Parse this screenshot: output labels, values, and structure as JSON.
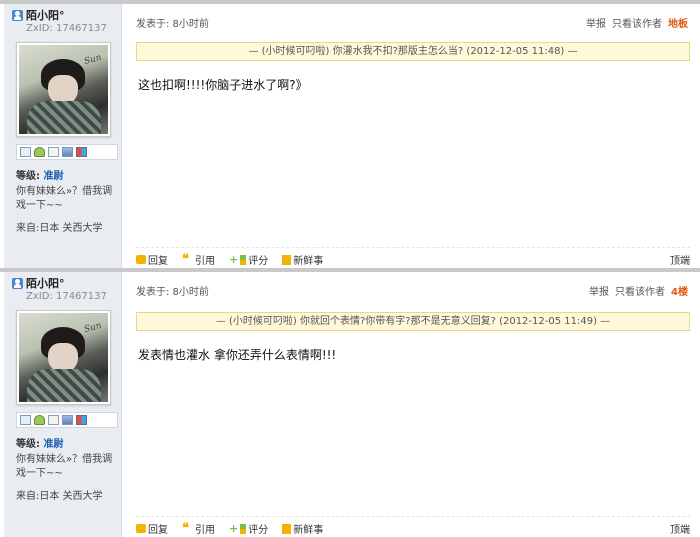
{
  "posts": [
    {
      "username": "陌小阳°",
      "zxid": "ZxID: 17467137",
      "avatar_signature": "Sun",
      "level_label": "等级:",
      "level_value": "准尉",
      "bio": "你有妹妹么»？借我调戏一下~~",
      "from": "来自:日本 关西大学",
      "time": "发表于: 8小时前",
      "actions": [
        "举报",
        "只看该作者"
      ],
      "floor": "地板",
      "quote": "— (小时候可叼啦) 你灌水我不扣?那版主怎么当? (2012-12-05 11:48) —",
      "content": "这也扣啊!!!!你脑子进水了啊?》",
      "footer": [
        "回复",
        "引用",
        "评分",
        "新鲜事"
      ],
      "top": "顶端"
    },
    {
      "username": "陌小阳°",
      "zxid": "ZxID: 17467137",
      "avatar_signature": "Sun",
      "level_label": "等级:",
      "level_value": "准尉",
      "bio": "你有妹妹么»？借我调戏一下~~",
      "from": "来自:日本 关西大学",
      "time": "发表于: 8小时前",
      "actions": [
        "举报",
        "只看该作者"
      ],
      "floor": "4楼",
      "quote": "— (小时候可叼啦) 你就回个表情?你带有字?那不是无意义回复? (2012-12-05 11:49) —",
      "content": "发表情也灌水 拿你还弄什么表情啊!!!",
      "footer": [
        "回复",
        "引用",
        "评分",
        "新鲜事"
      ],
      "top": "顶端"
    }
  ],
  "icons": {
    "toolbar": [
      "mail-icon",
      "add-friend-icon",
      "profile-icon",
      "album-icon",
      "app-icon"
    ],
    "footer": [
      "reply-icon",
      "quote-icon",
      "rate-icon",
      "fresh-icon"
    ]
  },
  "colors": {
    "floor": "#e35a0f",
    "level": "#1d5fb3",
    "quote_bg": "#fff9d9",
    "sidebar_bg": "#e9edf2"
  }
}
